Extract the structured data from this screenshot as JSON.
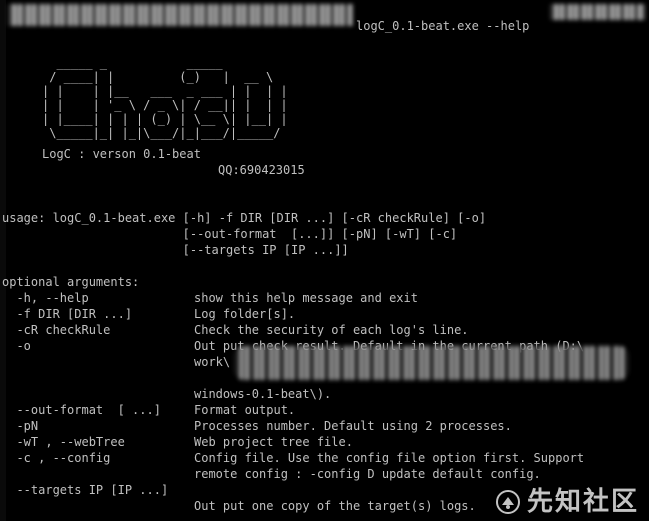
{
  "console": {
    "title_command": "logC_0.1-beat.exe --help",
    "ascii_art": "  _____ _           _____\n / ____| |         (_)   |  __ \\\n| |    | |__   ___  _ ___ | |  | |\n| |    | '_ \\ / _ \\| / __|| |  | |\n| |____| | | | (_) | \\__ \\| |__| |\n \\_____|_| |_|\\___/|_|___/|_____/",
    "version_line": "LogC : verson 0.1-beat",
    "qq_line": "QQ:690423015",
    "usage_lines": [
      "usage: logC_0.1-beat.exe [-h] -f DIR [DIR ...] [-cR checkRule] [-o]",
      "                         [--out-format  [...]] [-pN] [-wT] [-c]",
      "                         [--targets IP [IP ...]]"
    ],
    "optional_header": "optional arguments:",
    "args": [
      {
        "flag": "  -h, --help",
        "desc": "show this help message and exit"
      },
      {
        "flag": "  -f DIR [DIR ...]",
        "desc": "Log folder[s]."
      },
      {
        "flag": "  -cR checkRule",
        "desc": "Check the security of each log's line."
      },
      {
        "flag": "  -o",
        "desc": "Out put check result. Default in the current path (D:\\"
      },
      {
        "flag": "",
        "desc": "work\\"
      },
      {
        "flag": "",
        "desc": "windows-0.1-beat\\)."
      },
      {
        "flag": "  --out-format  [ ...]",
        "desc": "Format output."
      },
      {
        "flag": "  -pN",
        "desc": "Processes number. Default using 2 processes."
      },
      {
        "flag": "  -wT , --webTree",
        "desc": "Web project tree file."
      },
      {
        "flag": "  -c , --config",
        "desc": "Config file. Use the config file option first. Support"
      },
      {
        "flag": "",
        "desc": "remote config : -config D update default config."
      },
      {
        "flag": "  --targets IP [IP ...]",
        "desc": ""
      },
      {
        "flag": "",
        "desc": "Out put one copy of the target(s) logs."
      }
    ]
  },
  "watermark": {
    "text": "先知社区",
    "icon": "xianzhi-logo-icon"
  },
  "colors": {
    "background": "#000000",
    "text": "#c0c0c0"
  }
}
